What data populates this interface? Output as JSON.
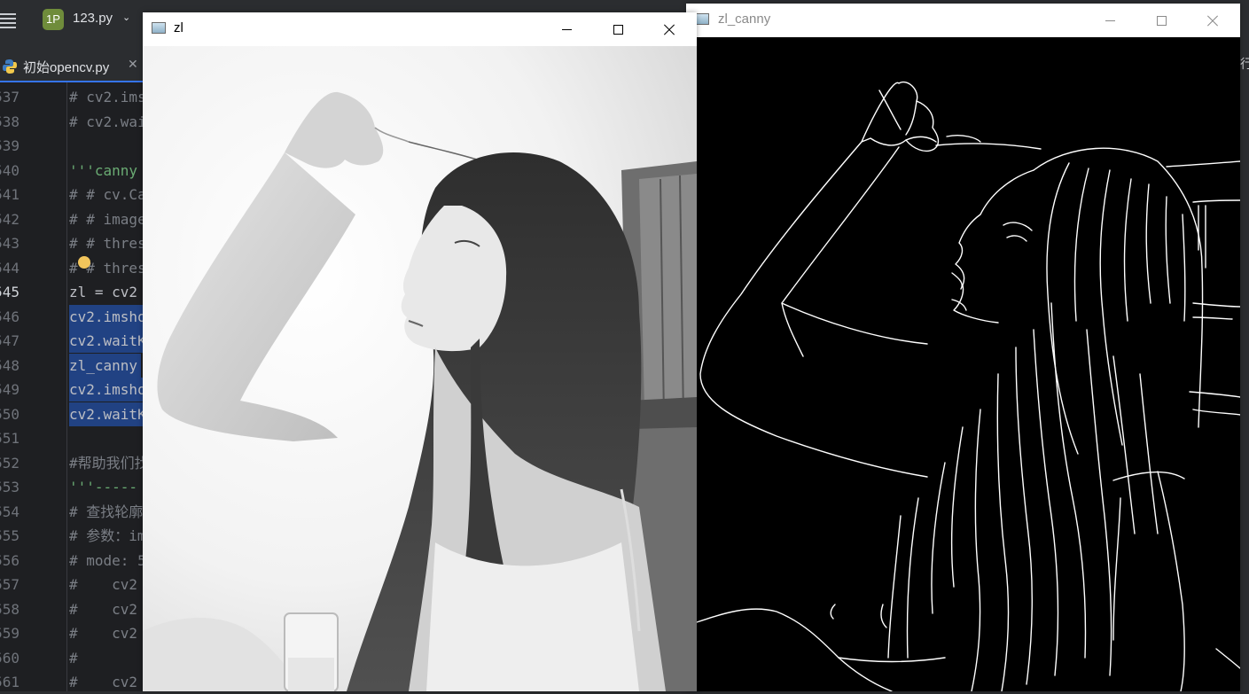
{
  "ide": {
    "project_badge": "1P",
    "project_name": "123.py",
    "project_chevron": "chevron-down-icon",
    "active_tab": "初始opencv.py",
    "tab_icon": "python-file-icon",
    "accent_color": "#3574f0",
    "selection_color": "#214283",
    "right_edge_char": "行",
    "lines": [
      {
        "num": "537",
        "text": "# cv2.ims",
        "kind": "comment"
      },
      {
        "num": "538",
        "text": "# cv2.wai",
        "kind": "comment"
      },
      {
        "num": "539",
        "text": "",
        "kind": "plain"
      },
      {
        "num": "540",
        "text": "'''canny",
        "kind": "str"
      },
      {
        "num": "541",
        "text": "# # cv.Ca",
        "kind": "comment"
      },
      {
        "num": "542",
        "text": "# # image",
        "kind": "comment"
      },
      {
        "num": "543",
        "text": "# # thres",
        "kind": "comment"
      },
      {
        "num": "544",
        "text": "# # thres",
        "kind": "comment"
      },
      {
        "num": "545",
        "text": "zl = cv2",
        "kind": "plain"
      },
      {
        "num": "546",
        "text": "cv2.imsho",
        "kind": "sel"
      },
      {
        "num": "547",
        "text": "cv2.waitK",
        "kind": "sel"
      },
      {
        "num": "548",
        "text": "zl_canny",
        "kind": "sel"
      },
      {
        "num": "549",
        "text": "cv2.imsho",
        "kind": "sel"
      },
      {
        "num": "550",
        "text": "cv2.waitK",
        "kind": "sel"
      },
      {
        "num": "551",
        "text": "",
        "kind": "plain"
      },
      {
        "num": "552",
        "text": "#帮助我们找",
        "kind": "comment"
      },
      {
        "num": "553",
        "text": "'''-----",
        "kind": "str"
      },
      {
        "num": "554",
        "text": "# 查找轮廓",
        "kind": "comment"
      },
      {
        "num": "555",
        "text": "# 参数：im",
        "kind": "comment"
      },
      {
        "num": "556",
        "text": "# mode: 5",
        "kind": "comment"
      },
      {
        "num": "557",
        "text": "#    cv2",
        "kind": "comment"
      },
      {
        "num": "558",
        "text": "#    cv2",
        "kind": "comment"
      },
      {
        "num": "559",
        "text": "#    cv2",
        "kind": "comment"
      },
      {
        "num": "560",
        "text": "#",
        "kind": "comment"
      },
      {
        "num": "561",
        "text": "#    cv2",
        "kind": "comment"
      }
    ],
    "current_line": "545"
  },
  "windows": {
    "zl": {
      "title": "zl",
      "icon": "opencv-window-icon",
      "content": "grayscale photo"
    },
    "canny": {
      "title": "zl_canny",
      "icon": "opencv-window-icon",
      "content": "edge detection output"
    }
  }
}
